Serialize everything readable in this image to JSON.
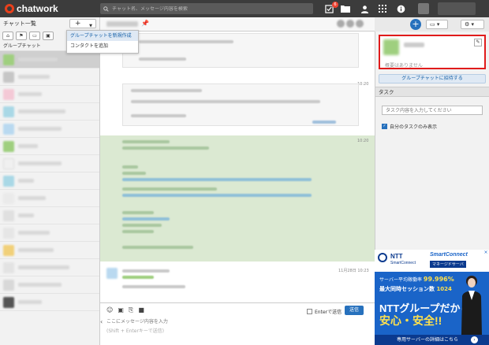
{
  "app": {
    "logo_text": "chatwork",
    "brand_color": "#e8401c",
    "accent_color": "#2771bd",
    "highlight_color": "#e01b1b"
  },
  "topbar": {
    "search_placeholder": "チャット名、メッセージ内容を検索",
    "task_badge_count": "6",
    "icons": [
      "task-icon",
      "file-icon",
      "contact-icon",
      "add-contact-icon",
      "apps-grid-icon",
      "info-icon"
    ]
  },
  "sidebar": {
    "title": "チャット一覧",
    "add_label": "+",
    "group_section": "グループチャット",
    "filters": [
      "home-icon",
      "flag-icon",
      "message-icon",
      "contact-icon"
    ]
  },
  "add_menu": {
    "items": [
      {
        "label": "グループチャットを新規作成"
      },
      {
        "label": "コンタクトを追加"
      }
    ]
  },
  "timeline": {
    "times": [
      "10:20",
      "10:20",
      "11月28日 10:23"
    ]
  },
  "composer": {
    "placeholder": "ここにメッセージ内容を入力",
    "hint": "(Shift + Enterキーで送信)",
    "enter_send_label": "Enterで送信",
    "send_label": "送信"
  },
  "right_panel": {
    "no_description": "概要はありません",
    "invite_label": "グループチャットに招待する",
    "task_title": "タスク",
    "task_placeholder": "タスク内容を入力してください",
    "my_task_label": "自分のタスクのみ表示"
  },
  "ad": {
    "brand": "NTT",
    "brand_sub": "SmartConnect",
    "product": "SmartConnect",
    "product_sub": "マネージドサーバ",
    "line1_prefix": "サーバー平均稼働率",
    "line1_value": "99.996%",
    "line2_prefix": "最大同時セッション数",
    "line2_value": "1024",
    "headline1": "NTTグループだから",
    "headline2": "安心・安全!!",
    "footer": "専用サーバーの詳細はこちら"
  }
}
